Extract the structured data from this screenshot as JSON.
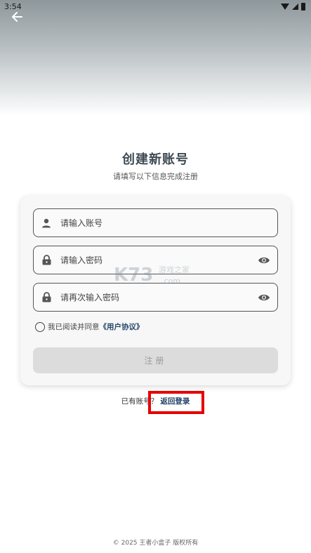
{
  "status_bar": {
    "time": "3:54"
  },
  "header": {
    "back_icon": "arrow-left-icon"
  },
  "page": {
    "title": "创建新账号",
    "subtitle": "请填写以下信息完成注册"
  },
  "form": {
    "account": {
      "placeholder": "请输入账号",
      "icon": "person-icon"
    },
    "password": {
      "placeholder": "请输入密码",
      "icon": "lock-icon"
    },
    "confirm_password": {
      "placeholder": "请再次输入密码",
      "icon": "lock-icon"
    },
    "agree_text": "我已阅读并同意",
    "agree_link": "《用户协议》",
    "register_label": "注册"
  },
  "login": {
    "prompt": "已有账号？",
    "link": "返回登录"
  },
  "footer": {
    "copyright": "© 2025 王者小盒子 版权所有"
  },
  "watermark": {
    "text": "K73",
    "sub": "游戏之家",
    "domain": ".com"
  },
  "colors": {
    "accent": "#3f4b53",
    "highlight": "#e60000",
    "link": "#1f3a66"
  }
}
